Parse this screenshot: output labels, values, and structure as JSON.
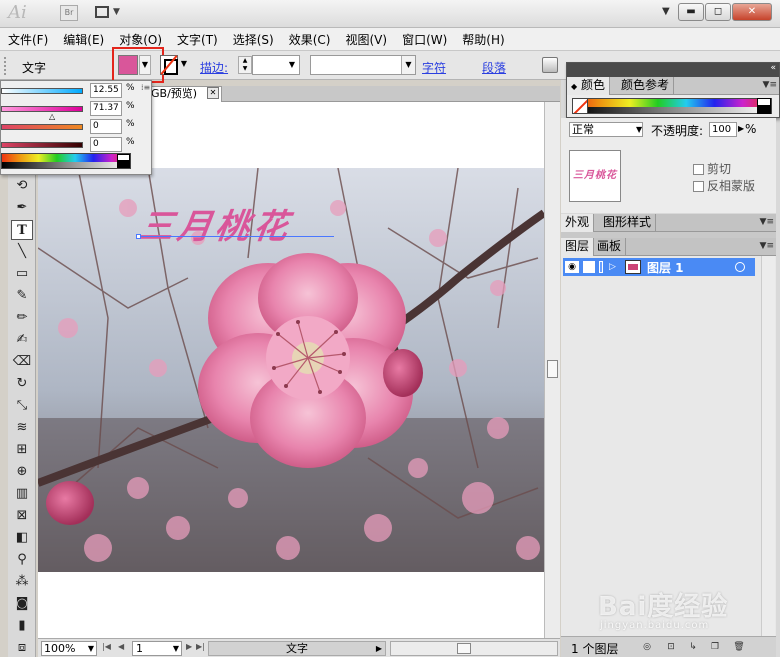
{
  "app": {
    "logo": "Ai",
    "bridge_label": "Br"
  },
  "window_buttons": {
    "minimize": "▬",
    "restore": "◻",
    "close": "✕"
  },
  "menu": [
    "文件(F)",
    "编辑(E)",
    "对象(O)",
    "文字(T)",
    "选择(S)",
    "效果(C)",
    "视图(V)",
    "窗口(W)",
    "帮助(H)"
  ],
  "control_bar": {
    "label": "文字",
    "fill_color": "#d9569a",
    "stroke_label": "描边:",
    "char_link": "字符",
    "para_link": "段落"
  },
  "color_popup": {
    "values": [
      "12.55",
      "71.37",
      "0",
      "0"
    ],
    "unit": "%",
    "colors": [
      "#0ff",
      "#f0f",
      "#ff0",
      "#000"
    ]
  },
  "document": {
    "tab_title": "GB/预览)",
    "tab_close": "✕",
    "text_on_canvas": "三月桃花"
  },
  "status": {
    "zoom": "100%",
    "page": "1",
    "mode": "文字"
  },
  "panels": {
    "color_tabs": [
      "颜色",
      "颜色参考"
    ],
    "blend_mode": "正常",
    "opacity_label": "不透明度:",
    "opacity_value": "100",
    "opacity_unit": "%",
    "thumb_text": "三月桃花",
    "clip_label": "剪切",
    "invert_label": "反相蒙版",
    "appearance_tabs": [
      "外观",
      "图形样式"
    ],
    "layers_tabs": [
      "图层",
      "画板"
    ],
    "layer_name": "图层 1",
    "layer_count": "1 个图层"
  },
  "watermark": {
    "main": "Bai度经验",
    "sub": "jingyan.baidu.com"
  }
}
